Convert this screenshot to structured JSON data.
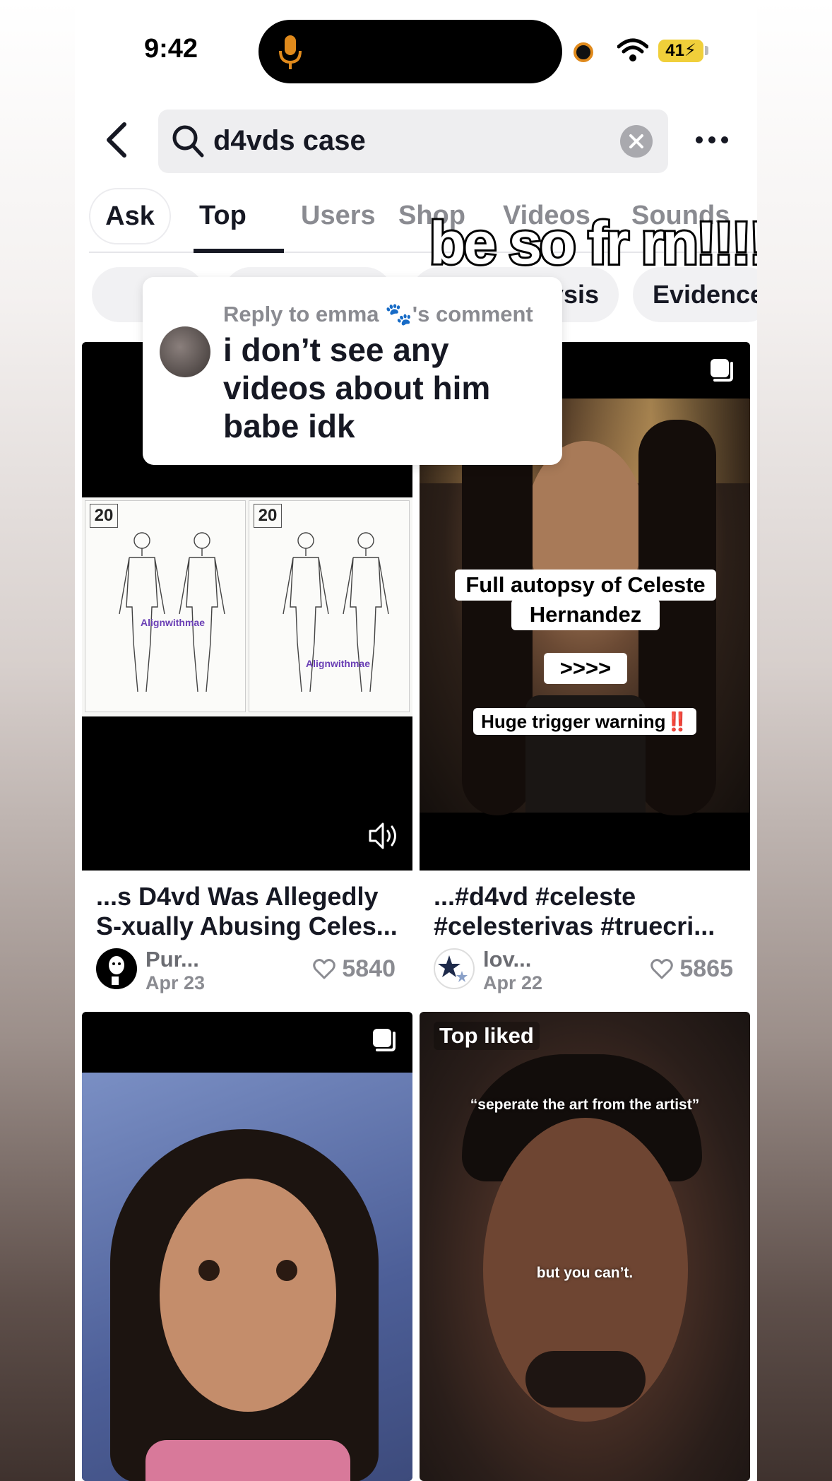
{
  "status": {
    "time": "9:42",
    "battery": "41"
  },
  "search": {
    "query": "d4vds case"
  },
  "tabs": [
    {
      "label": "Ask"
    },
    {
      "label": "Top"
    },
    {
      "label": "Users"
    },
    {
      "label": "Shop"
    },
    {
      "label": "Videos"
    },
    {
      "label": "Sounds"
    }
  ],
  "chips": [
    {
      "label": "l Analysis"
    },
    {
      "label": "Evidence"
    }
  ],
  "overlay_text": "be so fr rn!!!!",
  "reply": {
    "reply_to": "Reply to emma 🐾's comment",
    "text": "i don’t see any videos about him babe idk"
  },
  "cards": [
    {
      "title": "...s D4vd Was Allegedly S-xually Abusing Celes...",
      "author": "Pur...",
      "date": "Apr 23",
      "likes": "5840",
      "doc_number_left": "20",
      "doc_number_right": "20",
      "watermark_left": "Alignwithmae",
      "watermark_right": "Alignwithmae"
    },
    {
      "title": "...#d4vd #celeste #celesterivas #truecri...",
      "author": "lov...",
      "date": "Apr 22",
      "likes": "5865",
      "caption_line1": "Full autopsy of Celeste",
      "caption_line2": "Hernandez",
      "caption_arrows": ">>>>",
      "caption_warning": "Huge trigger warning",
      "caption_warning_emoji": "‼️"
    },
    {
      "title": ""
    },
    {
      "badge": "Top liked",
      "caption_top": "“seperate the art from the artist”",
      "caption_mid": "but you can’t."
    }
  ]
}
